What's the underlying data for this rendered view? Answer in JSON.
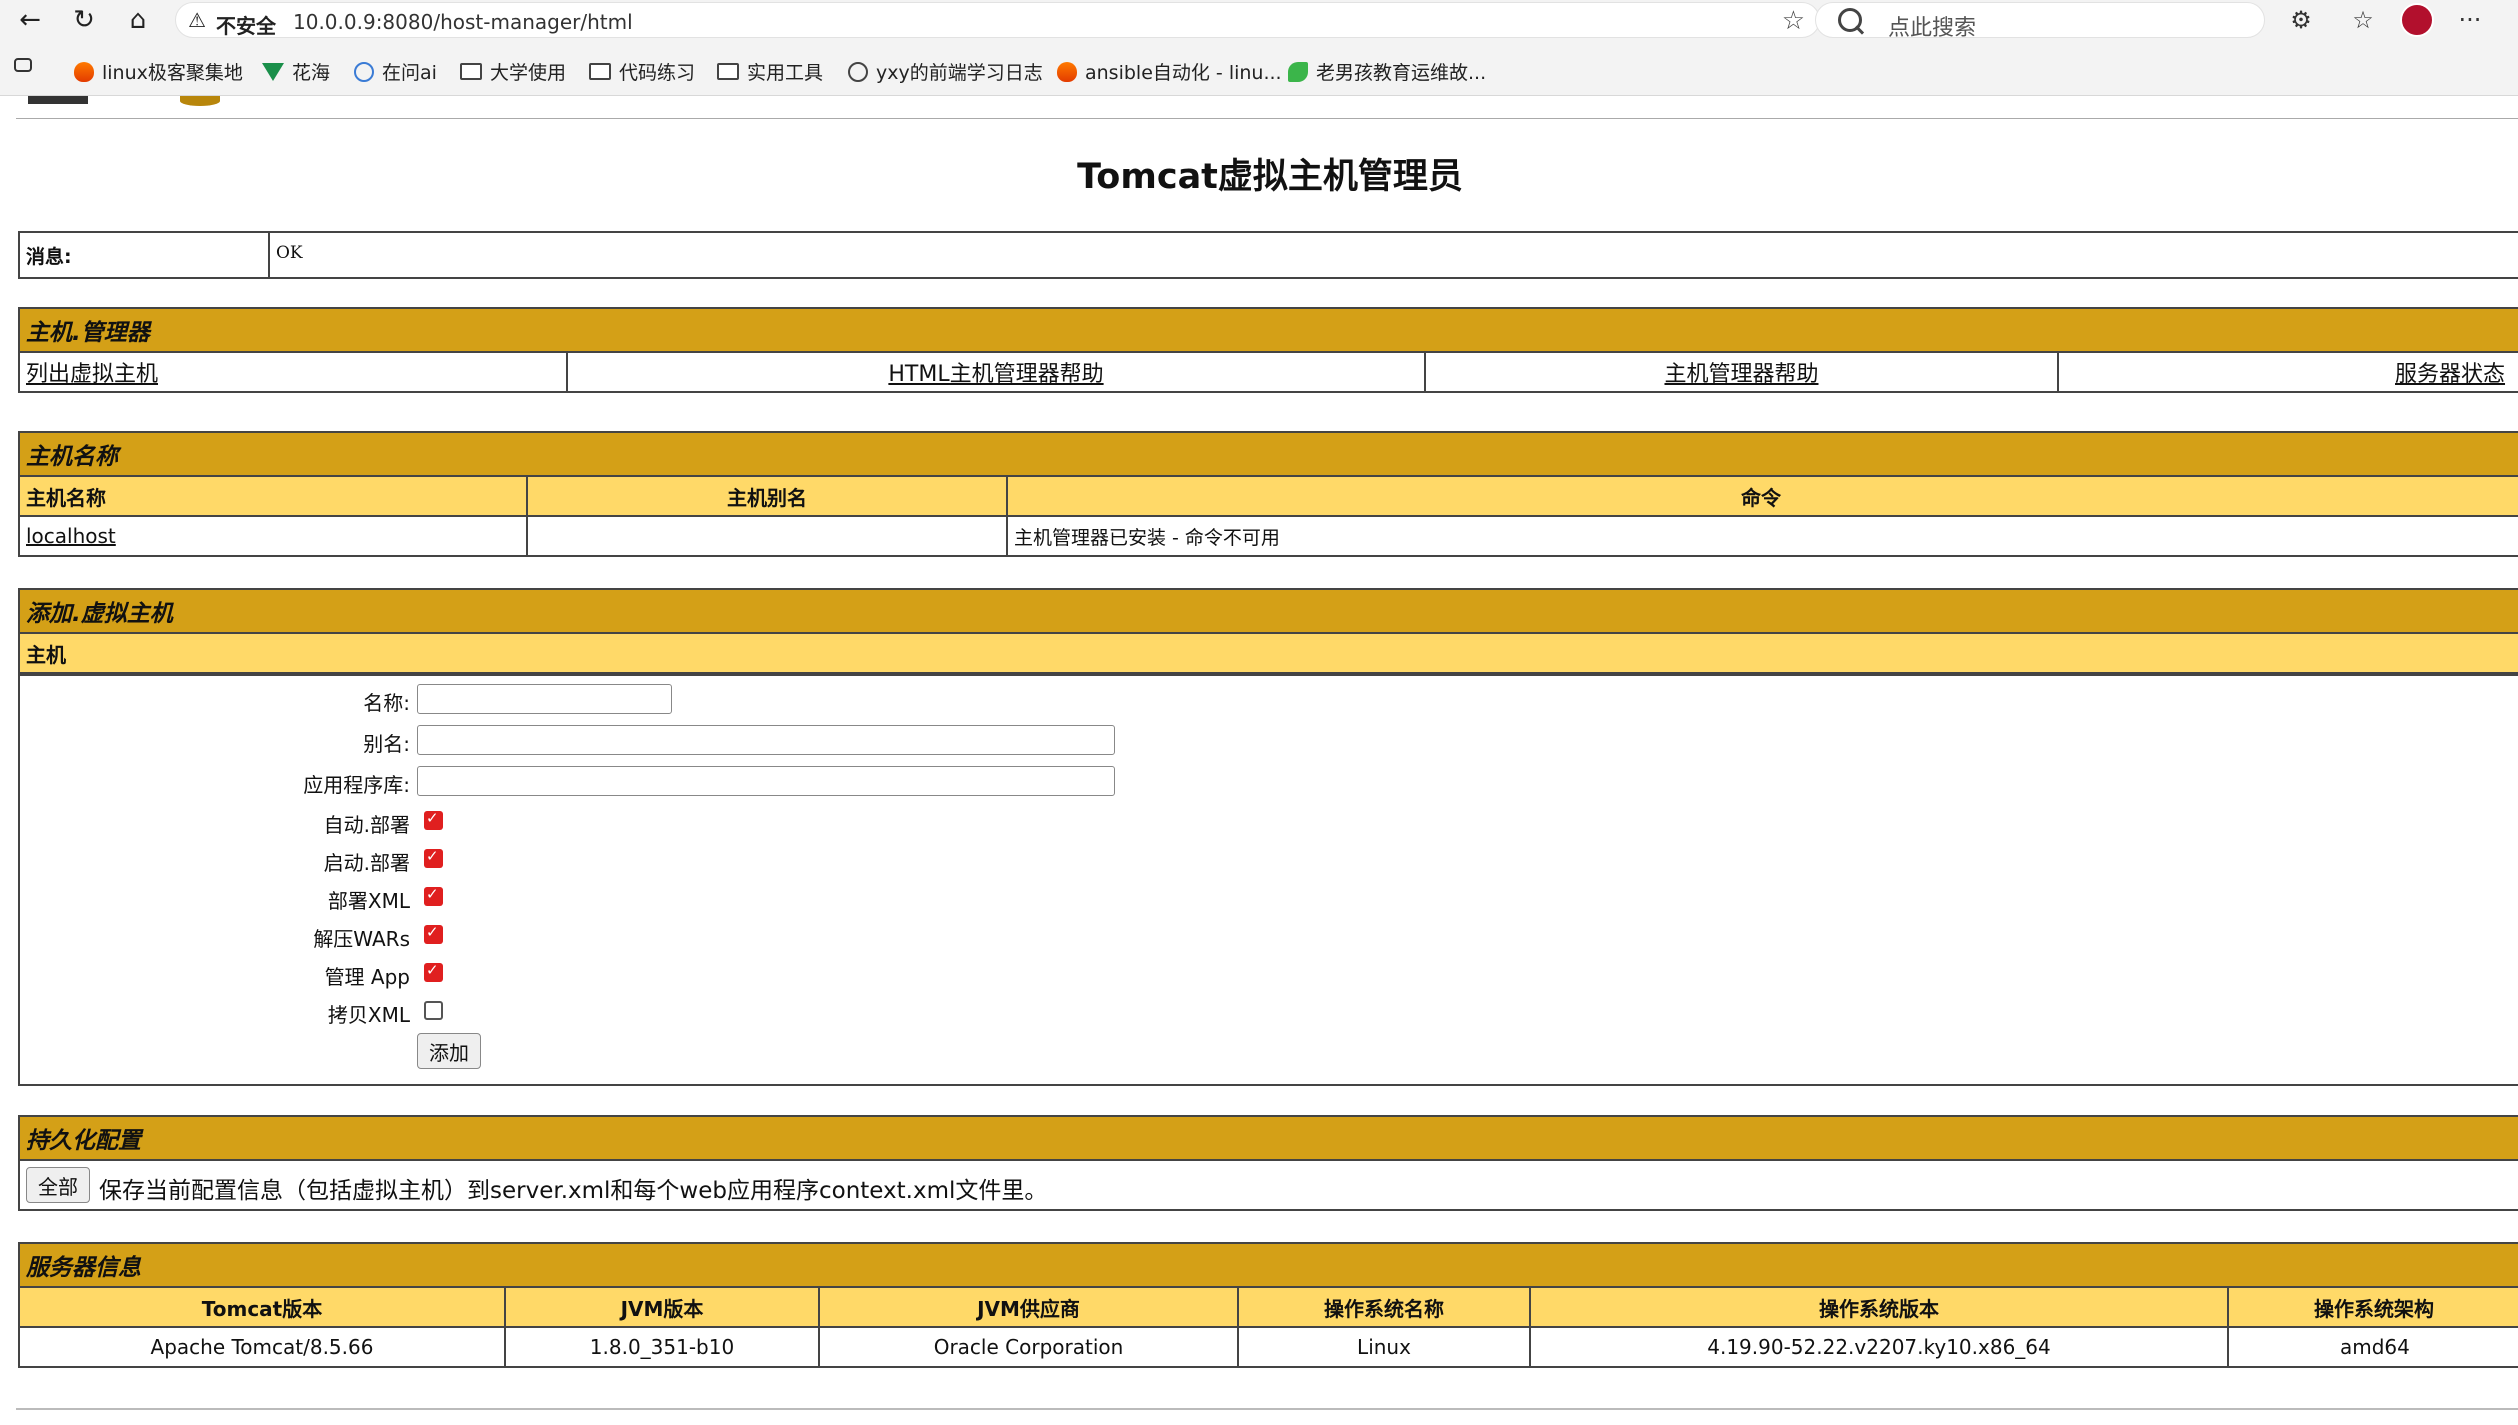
{
  "browser": {
    "url_warning": "不安全",
    "url": "10.0.0.9:8080/host-manager/html",
    "search_placeholder": "点此搜索",
    "bookmarks": [
      {
        "label": "linux极客聚集地",
        "icon": "fire-icon"
      },
      {
        "label": "花海",
        "icon": "vue-icon"
      },
      {
        "label": "在问ai",
        "icon": "ai-icon"
      },
      {
        "label": "大学使用",
        "icon": "folder-icon"
      },
      {
        "label": "代码练习",
        "icon": "folder-icon"
      },
      {
        "label": "实用工具",
        "icon": "folder-icon"
      },
      {
        "label": "yxy的前端学习日志",
        "icon": "globe-icon"
      },
      {
        "label": "ansible自动化 - linu...",
        "icon": "fire-icon"
      },
      {
        "label": "老男孩教育运维故...",
        "icon": "leaf-icon"
      }
    ]
  },
  "page": {
    "title": "Tomcat虚拟主机管理员",
    "message": {
      "label": "消息:",
      "value": "OK"
    },
    "host_manager": {
      "header": "主机.管理器",
      "links": [
        "列出虚拟主机",
        "HTML主机管理器帮助",
        "主机管理器帮助",
        "服务器状态"
      ]
    },
    "host_name_section": {
      "header": "主机名称",
      "columns": [
        "主机名称",
        "主机别名",
        "命令"
      ],
      "rows": [
        {
          "name": "localhost",
          "alias": "",
          "command": "主机管理器已安装 - 命令不可用"
        }
      ]
    },
    "add_host": {
      "header": "添加.虚拟主机",
      "subheader": "主机",
      "fields": [
        {
          "label": "名称:",
          "value": ""
        },
        {
          "label": "别名:",
          "value": ""
        },
        {
          "label": "应用程序库:",
          "value": ""
        }
      ],
      "checkboxes": [
        {
          "label": "自动.部署",
          "checked": true
        },
        {
          "label": "启动.部署",
          "checked": true
        },
        {
          "label": "部署XML",
          "checked": true
        },
        {
          "label": "解压WARs",
          "checked": true
        },
        {
          "label": "管理 App",
          "checked": true
        },
        {
          "label": "拷贝XML",
          "checked": false
        }
      ],
      "submit_label": "添加"
    },
    "persist": {
      "header": "持久化配置",
      "button_label": "全部",
      "description": "保存当前配置信息（包括虚拟主机）到server.xml和每个web应用程序context.xml文件里。"
    },
    "server_info": {
      "header": "服务器信息",
      "columns": [
        "Tomcat版本",
        "JVM版本",
        "JVM供应商",
        "操作系统名称",
        "操作系统版本",
        "操作系统架构"
      ],
      "values": [
        "Apache Tomcat/8.5.66",
        "1.8.0_351-b10",
        "Oracle Corporation",
        "Linux",
        "4.19.90-52.22.v2207.ky10.x86_64",
        "amd64"
      ]
    }
  }
}
